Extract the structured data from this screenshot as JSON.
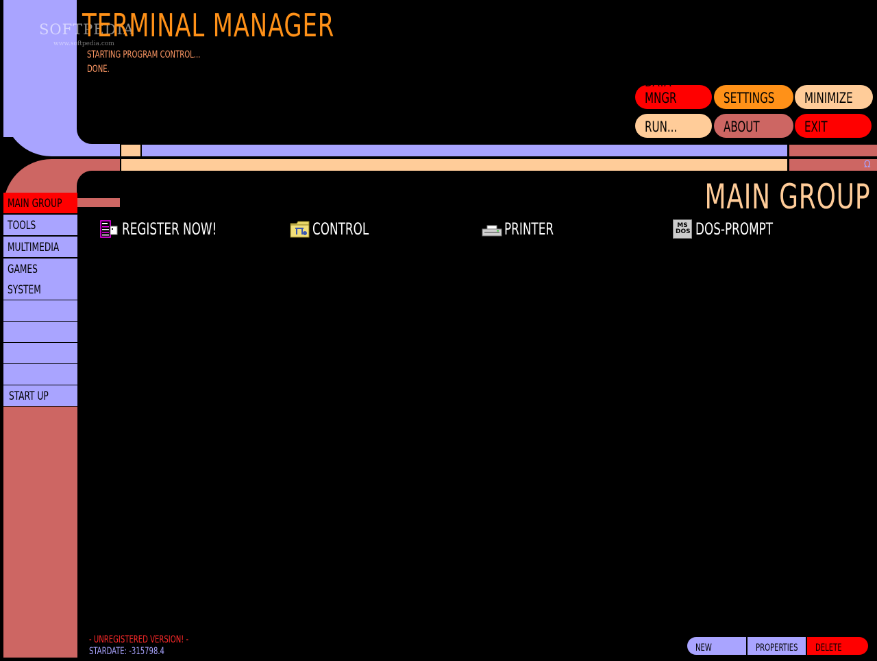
{
  "app_title": "Terminal Manager",
  "watermark": "SOFTPEDIA",
  "watermark_url": "www.softpedia.com",
  "status_lines": [
    "Starting program control...",
    "Done."
  ],
  "top_buttons": {
    "data_mngr": "Data Mngr",
    "settings": "Settings",
    "minimize": "Minimize",
    "run": "Run...",
    "about": "About",
    "exit": "Exit"
  },
  "omega_symbol": "Ω",
  "sidebar": {
    "items": [
      "Main Group",
      "Tools",
      "Multimedia",
      "Games",
      "System",
      "",
      "",
      "",
      "",
      "Start Up"
    ]
  },
  "group_title": "Main Group",
  "programs": [
    {
      "label": "Register Now!",
      "icon": "register-icon"
    },
    {
      "label": "Control",
      "icon": "control-folder-icon"
    },
    {
      "label": "Printer",
      "icon": "printer-icon"
    },
    {
      "label": "DOS-Prompt",
      "icon": "msdos-icon"
    }
  ],
  "msdos_icon_text": "MS DOS",
  "footer": {
    "unregistered": "- Unregistered Version! -",
    "stardate": "Stardate: -315798.4"
  },
  "bottom_buttons": {
    "new": "New",
    "properties": "Properties",
    "delete": "Delete"
  },
  "colors": {
    "lavender": "#a9a4ff",
    "salmon": "#cd6663",
    "peach": "#ffcc99",
    "orange": "#ff9118",
    "red": "#ff0000"
  }
}
